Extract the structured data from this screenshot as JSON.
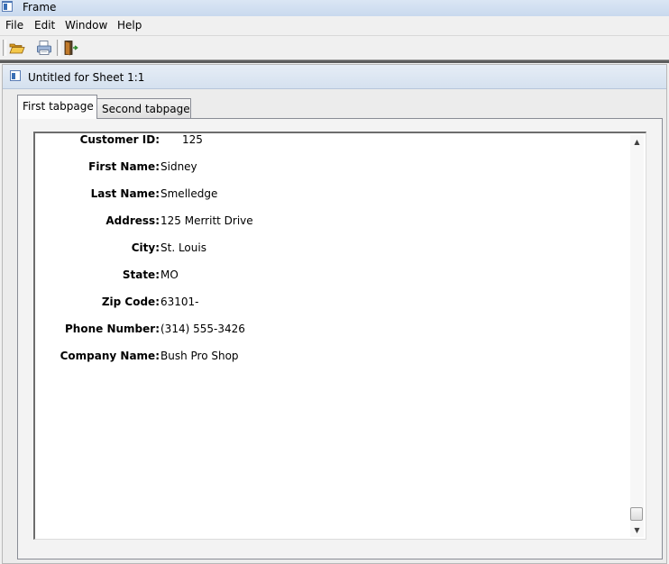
{
  "window": {
    "title": "Frame"
  },
  "menu": {
    "items": [
      "File",
      "Edit",
      "Window",
      "Help"
    ]
  },
  "toolbar": {
    "buttons": [
      {
        "icon": "open-folder-icon"
      },
      {
        "icon": "print-icon"
      },
      {
        "icon": "exit-door-icon"
      }
    ]
  },
  "inner_window": {
    "title": "Untitled for Sheet 1:1"
  },
  "tabs": [
    {
      "label": "First tabpage",
      "active": true
    },
    {
      "label": "Second tabpage",
      "active": false
    }
  ],
  "form": {
    "fields": [
      {
        "label": "Customer ID:",
        "value": "125"
      },
      {
        "label": "First Name:",
        "value": "Sidney"
      },
      {
        "label": "Last Name:",
        "value": "Smelledge"
      },
      {
        "label": "Address:",
        "value": "125 Merritt Drive"
      },
      {
        "label": "City:",
        "value": "St. Louis"
      },
      {
        "label": "State:",
        "value": "MO"
      },
      {
        "label": "Zip Code:",
        "value": "63101-"
      },
      {
        "label": "Phone Number:",
        "value": "(314) 555-3426"
      },
      {
        "label": "Company Name:",
        "value": "Bush Pro Shop"
      }
    ]
  },
  "scrollbar": {
    "up_glyph": "▲",
    "down_glyph": "▼"
  }
}
